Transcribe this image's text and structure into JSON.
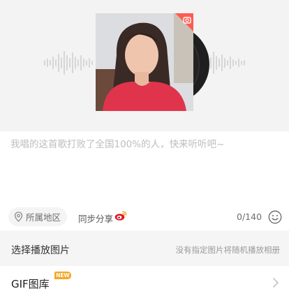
{
  "cover": {
    "camera_icon": "camera-icon",
    "accent_color": "#ff5a4f"
  },
  "caption": {
    "text": "我唱的这首歌打败了全国100%的人，快来听听吧~"
  },
  "options": {
    "location_icon": "location-pin-icon",
    "location_label": "所属地区",
    "sync_label": "同步分享",
    "weibo_icon": "weibo-icon",
    "char_count": "0/140",
    "emoji_icon": "emoji-icon"
  },
  "picture_select": {
    "title": "选择播放图片",
    "hint": "没有指定图片将随机播放相册"
  },
  "gif_library": {
    "title": "GIF图库",
    "badge": "NEW",
    "badge_color": "#f5a623",
    "chevron_icon": "chevron-right-icon"
  }
}
